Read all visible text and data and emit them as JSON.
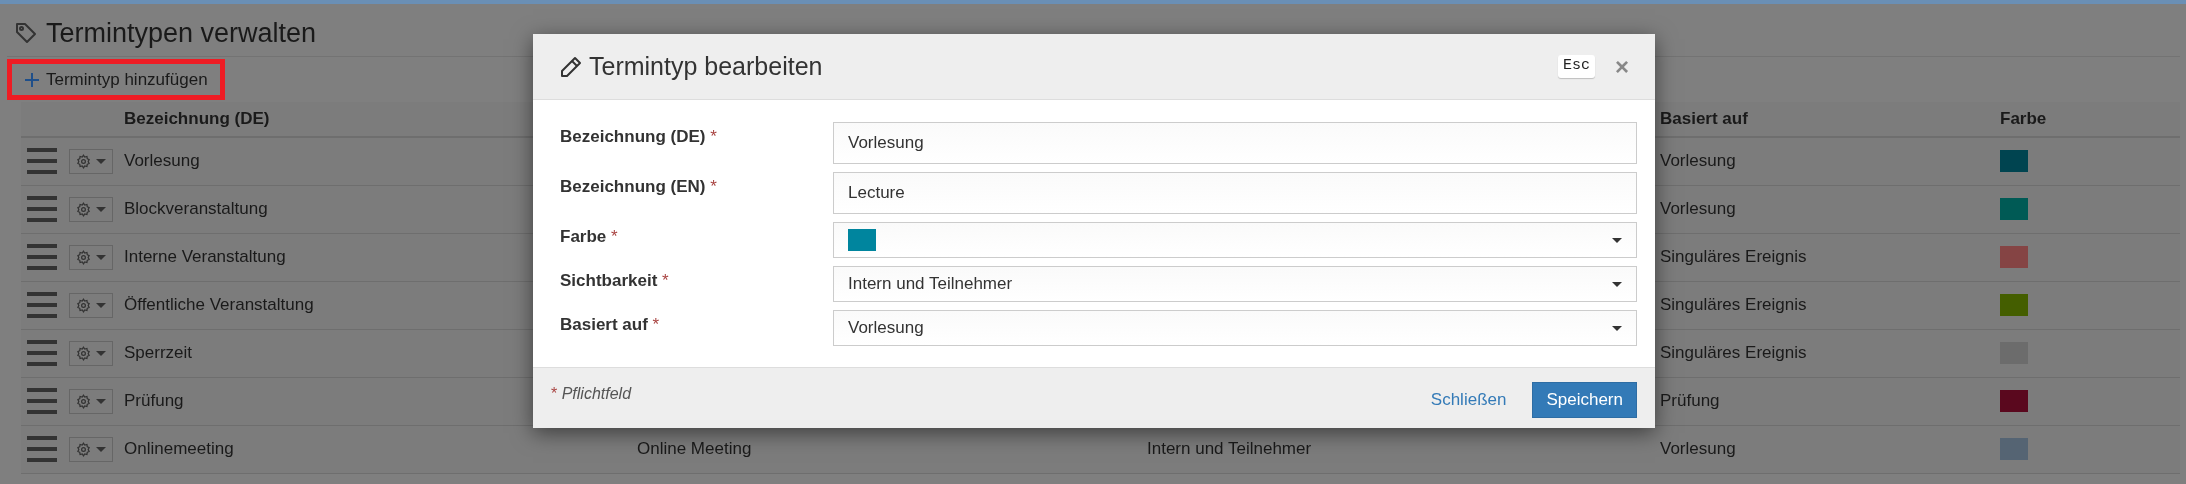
{
  "page": {
    "title": "Termintypen verwalten",
    "add_button": {
      "label": "Termintyp hinzufügen",
      "highlighted": true
    }
  },
  "table": {
    "columns": [
      {
        "label": "Bezeichnung (DE)"
      },
      {
        "label": "Basiert auf"
      },
      {
        "label": "Farbe"
      }
    ],
    "rows": [
      {
        "name": "Vorlesung",
        "based_on": "Vorlesung",
        "color": "#004450"
      },
      {
        "name": "Blockveranstaltung",
        "based_on": "Vorlesung",
        "color": "#005a55"
      },
      {
        "name": "Interne Veranstaltung",
        "based_on": "Singuläres Ereignis",
        "color": "#854444"
      },
      {
        "name": "Öffentliche Veranstaltung",
        "based_on": "Singuläres Ereignis",
        "color": "#445e00"
      },
      {
        "name": "Sperrzeit",
        "based_on": "Singuläres Ereignis",
        "color": "#6c6c6c"
      },
      {
        "name": "Prüfung",
        "based_on": "Prüfung",
        "color": "#5a081e"
      },
      {
        "name": "Onlinemeeting",
        "column_2": "Online Meeting",
        "column_3": "Intern und Teilnehmer",
        "based_on": "Vorlesung",
        "color": "#556473"
      }
    ]
  },
  "dialog": {
    "title": "Termintyp bearbeiten",
    "esc_key": "Esc",
    "close": "×",
    "fields": [
      {
        "kind": "text",
        "label": "Bezeichnung (DE)",
        "required_mark": "*",
        "value": "Vorlesung"
      },
      {
        "kind": "text",
        "label": "Bezeichnung (EN)",
        "required_mark": "*",
        "value": "Lecture"
      },
      {
        "kind": "color",
        "label": "Farbe",
        "required_mark": "*",
        "color": "#00859e"
      },
      {
        "kind": "select",
        "label": "Sichtbarkeit",
        "required_mark": "*",
        "value": "Intern und Teilnehmer"
      },
      {
        "kind": "select",
        "label": "Basiert auf",
        "required_mark": "*",
        "value": "Vorlesung"
      }
    ],
    "footer_note": {
      "mark": "*",
      "text": "Pflichtfeld"
    },
    "buttons": [
      {
        "kind": "link",
        "label": "Schließen"
      },
      {
        "kind": "primary",
        "label": "Speichern"
      }
    ]
  }
}
